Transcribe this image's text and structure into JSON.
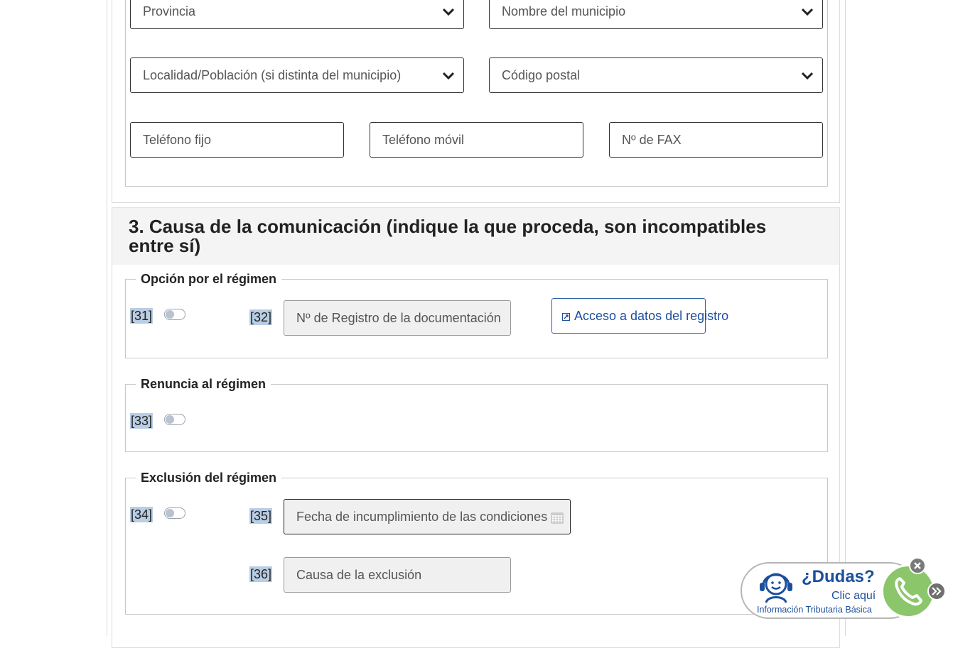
{
  "contact": {
    "provincia_placeholder": "Provincia",
    "municipio_placeholder": "Nombre del municipio",
    "localidad_placeholder": "Localidad/Población (si distinta del municipio)",
    "codigo_postal_placeholder": "Código postal",
    "telefono_fijo_placeholder": "Teléfono fijo",
    "telefono_movil_placeholder": "Teléfono móvil",
    "fax_placeholder": "Nº de FAX"
  },
  "section3": {
    "title": "3. Causa de la comunicación (indique la que proceda, son incompatibles entre sí)",
    "opcion": {
      "legend": "Opción por el régimen",
      "code_toggle": "[31]",
      "code_field": "[32]",
      "registro_placeholder": "Nº de Registro de la documentación",
      "link_label": "Acceso a datos del registro"
    },
    "renuncia": {
      "legend": "Renuncia al régimen",
      "code_toggle": "[33]"
    },
    "exclusion": {
      "legend": "Exclusión del régimen",
      "code_toggle": "[34]",
      "code_fecha": "[35]",
      "fecha_placeholder": "Fecha de incumplimiento de las condiciones",
      "code_causa": "[36]",
      "causa_placeholder": "Causa de la exclusión"
    }
  },
  "help_widget": {
    "title": "¿Dudas?",
    "click_label": "Clic aquí",
    "subtitle": "Información Tributaria Básica"
  },
  "icons": {
    "dropdown": "chevron-down-icon",
    "link": "external-link-icon",
    "calendar": "calendar-icon",
    "agent": "headset-agent-icon",
    "phone": "phone-icon",
    "close": "close-icon",
    "expand": "double-chevron-right-icon"
  },
  "colors": {
    "link": "#1d4f9e",
    "toggle_knob": "#b8c3cf",
    "code_highlight": "#b9cde4",
    "phone_green": "#8bc66a"
  }
}
